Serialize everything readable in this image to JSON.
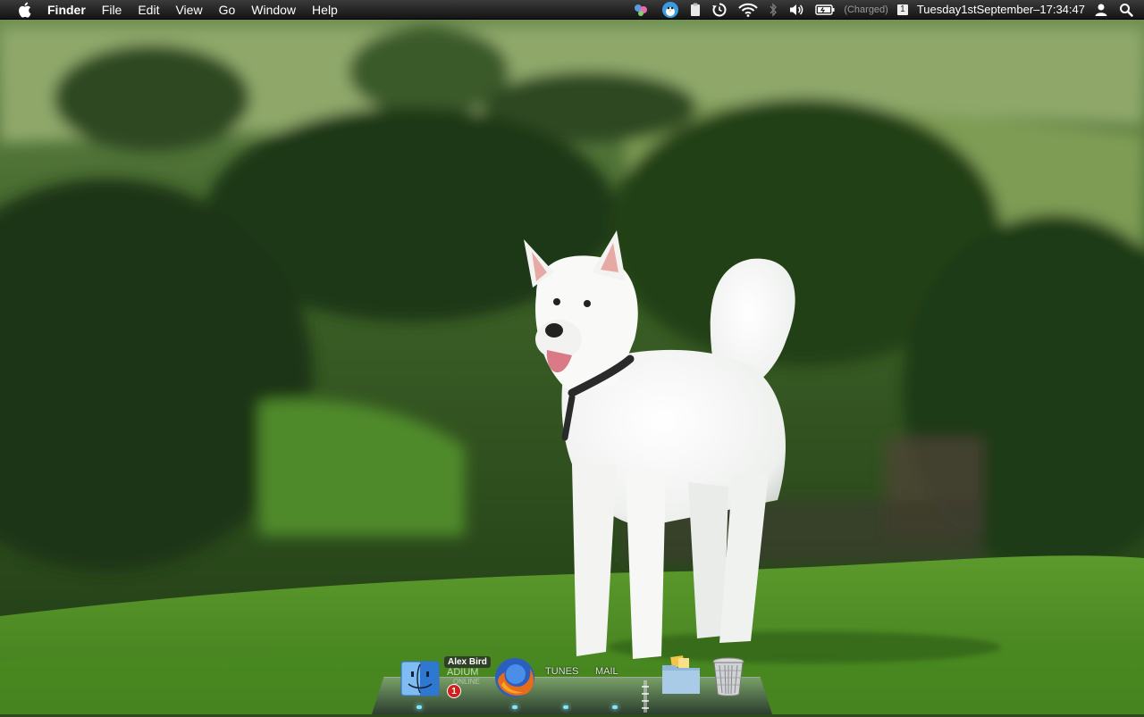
{
  "menubar": {
    "app_name": "Finder",
    "menus": [
      "File",
      "Edit",
      "View",
      "Go",
      "Window",
      "Help"
    ],
    "status": {
      "battery_state": "(Charged)",
      "display_badge": "1",
      "datetime": "Tuesday1stSeptember–17:34:47"
    }
  },
  "icons": {
    "apple": "apple-icon",
    "messenger": "messenger-icon",
    "chat_bird": "chat-bird-icon",
    "clipboard": "clipboard-icon",
    "time_machine": "time-machine-icon",
    "wifi": "wifi-icon",
    "bluetooth": "bluetooth-icon",
    "volume": "volume-icon",
    "battery": "battery-icon",
    "user": "user-icon",
    "spotlight": "spotlight-icon"
  },
  "dock": {
    "adium": {
      "contact": "Alex Bird",
      "label": "ADIUM",
      "status": "ONLINE",
      "badge": "1"
    },
    "itunes_label": "TUNES",
    "mail_label": "MAIL"
  },
  "colors": {
    "menubar": "#1e1e1e",
    "badge": "#d0211c",
    "indicator": "#7fe7ff"
  }
}
